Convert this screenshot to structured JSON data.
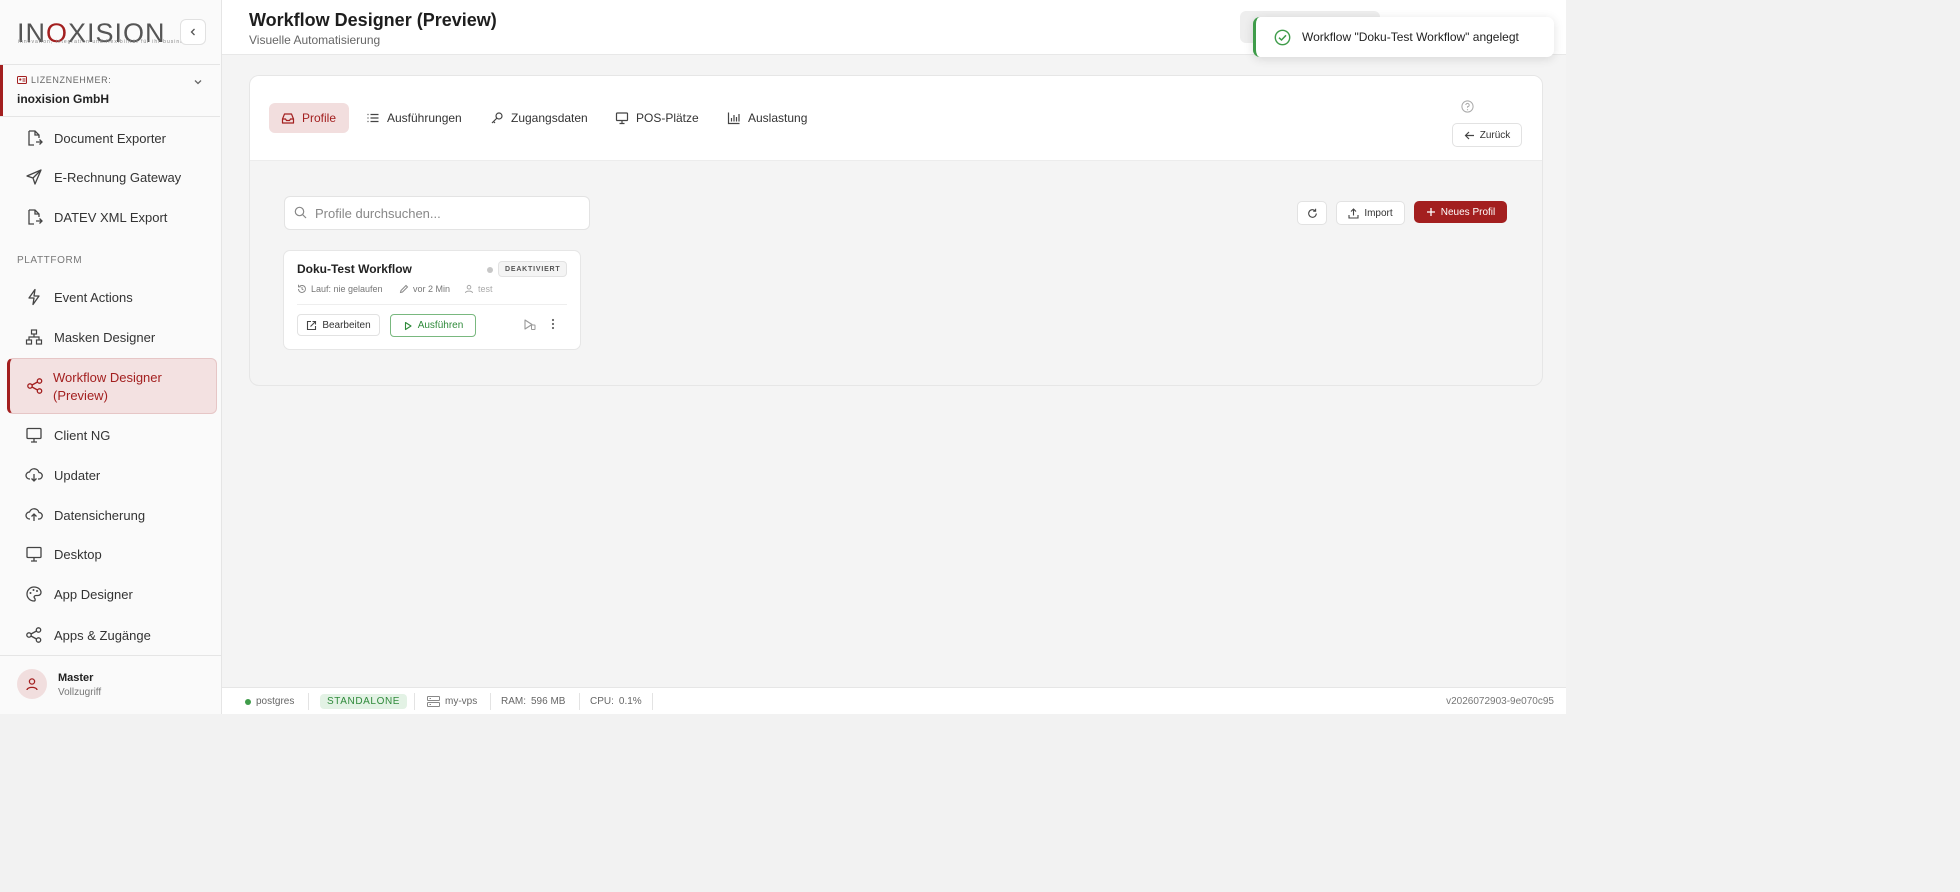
{
  "brand": {
    "logo_text_part1": "IN",
    "logo_text_red": "O",
    "logo_text_part2": "XISION",
    "logo_tagline": "innovation, integration und flexibilität für ihr business"
  },
  "license": {
    "label": "LIZENZNEHMER:",
    "value": "inoxision GmbH"
  },
  "sidebar": {
    "items_top": [
      {
        "label": "Document Exporter",
        "icon": "file-export-icon"
      },
      {
        "label": "E-Rechnung Gateway",
        "icon": "send-icon"
      },
      {
        "label": "DATEV XML Export",
        "icon": "file-export-icon"
      }
    ],
    "section_label": "PLATTFORM",
    "items_platform": [
      {
        "label": "Event Actions",
        "icon": "lightning-icon"
      },
      {
        "label": "Masken Designer",
        "icon": "hierarchy-icon"
      },
      {
        "label": "Workflow Designer (Preview)",
        "icon": "share-icon",
        "active": true
      },
      {
        "label": "Client NG",
        "icon": "monitor-icon"
      },
      {
        "label": "Updater",
        "icon": "cloud-download-icon"
      },
      {
        "label": "Datensicherung",
        "icon": "cloud-upload-icon"
      },
      {
        "label": "Desktop",
        "icon": "monitor-icon"
      },
      {
        "label": "App Designer",
        "icon": "palette-icon"
      },
      {
        "label": "Apps & Zugänge",
        "icon": "share-icon"
      }
    ],
    "active_line1": "Workflow Designer",
    "active_line2": "(Preview)"
  },
  "user": {
    "name": "Master",
    "role": "Vollzugriff"
  },
  "header": {
    "title": "Workflow Designer (Preview)",
    "subtitle": "Visuelle Automatisierung"
  },
  "toast": {
    "message": "Workflow \"Doku-Test Workflow\" angelegt",
    "color": "#3f9c4a"
  },
  "tabs": [
    {
      "label": "Profile",
      "icon": "inbox-icon",
      "active": true
    },
    {
      "label": "Ausführungen",
      "icon": "list-icon"
    },
    {
      "label": "Zugangsdaten",
      "icon": "key-icon"
    },
    {
      "label": "POS-Plätze",
      "icon": "monitor-icon"
    },
    {
      "label": "Auslastung",
      "icon": "bar-chart-icon"
    }
  ],
  "back_label": "Zurück",
  "search": {
    "placeholder": "Profile durchsuchen...",
    "value": ""
  },
  "toolbar": {
    "import_label": "Import",
    "new_label": "Neues Profil"
  },
  "profile": {
    "title": "Doku-Test Workflow",
    "status": "DEAKTIVIERT",
    "last_run": "Lauf: nie gelaufen",
    "edited": "vor 2 Min",
    "owner": "test",
    "edit_label": "Bearbeiten",
    "run_label": "Ausführen"
  },
  "statusbar": {
    "db": "postgres",
    "mode": "STANDALONE",
    "host": "my-vps",
    "ram_label": "RAM:",
    "ram_value": "596 MB",
    "cpu_label": "CPU:",
    "cpu_value": "0.1%",
    "version": "v2026072903-9e070c95"
  },
  "colors": {
    "accent": "#a31f1f",
    "success": "#3f9c4a"
  }
}
